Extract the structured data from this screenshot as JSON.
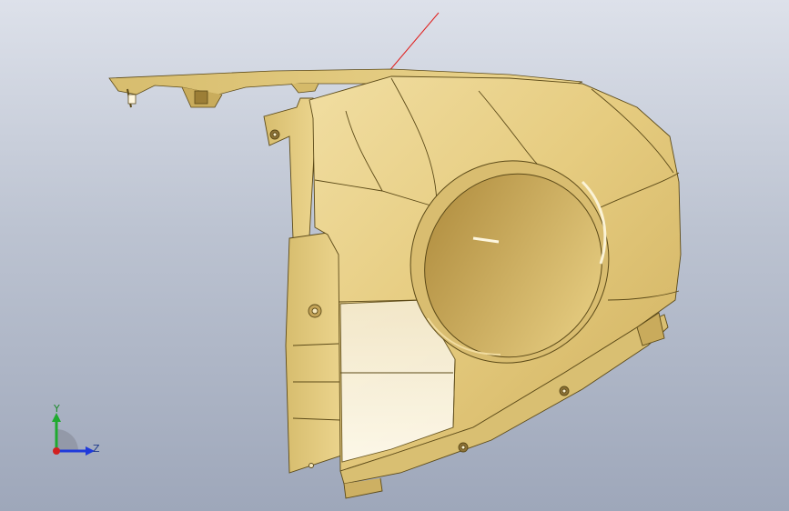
{
  "viewport": {
    "background_top": "#dde1ea",
    "background_bottom": "#9ea7ba"
  },
  "model": {
    "part_color": "#e8cf86",
    "highlight_color": "#fbf3d6",
    "edge_color": "#5c4a18"
  },
  "triad": {
    "y_label": "Y",
    "z_label": "Z",
    "x_color": "#d22020",
    "y_color": "#1faa2f",
    "z_color": "#1f3adb"
  },
  "indicator_line_color": "#e0201e"
}
